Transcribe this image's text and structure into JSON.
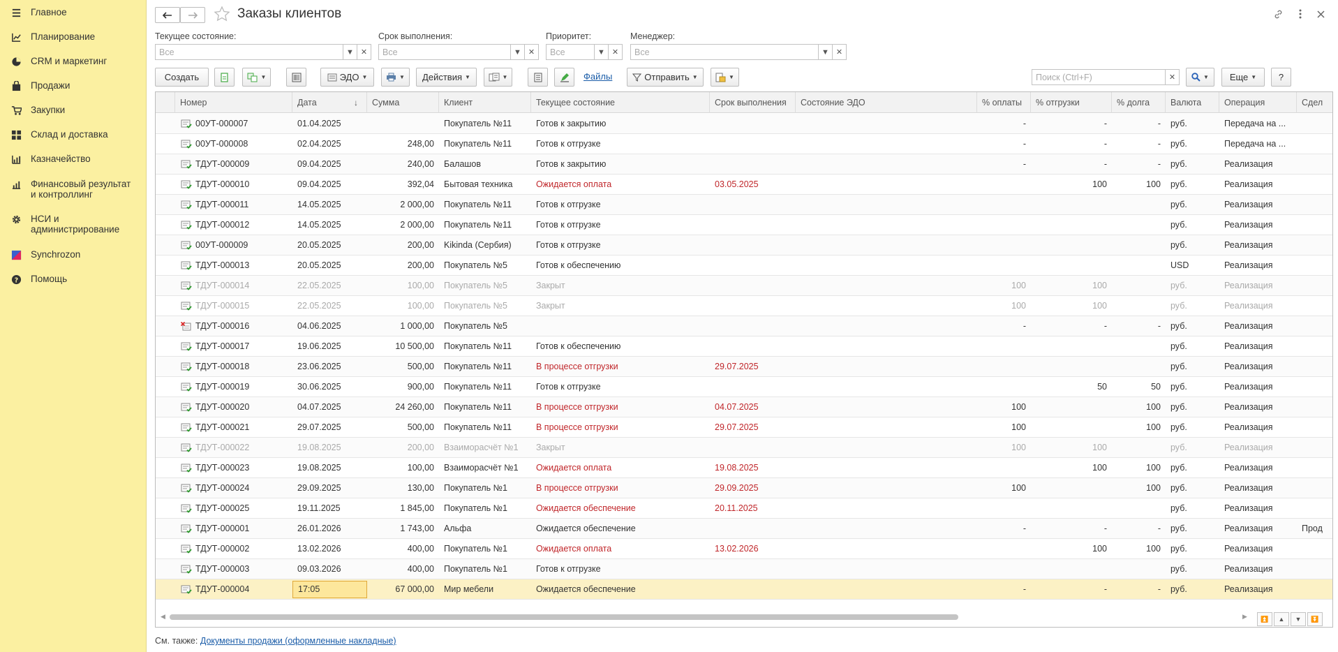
{
  "sidebar": {
    "items": [
      {
        "label": "Главное",
        "icon": "menu-icon"
      },
      {
        "label": "Планирование",
        "icon": "planning-icon"
      },
      {
        "label": "CRM и маркетинг",
        "icon": "crm-icon"
      },
      {
        "label": "Продажи",
        "icon": "sales-icon"
      },
      {
        "label": "Закупки",
        "icon": "cart-icon"
      },
      {
        "label": "Склад и доставка",
        "icon": "warehouse-icon"
      },
      {
        "label": "Казначейство",
        "icon": "treasury-icon"
      },
      {
        "label": "Финансовый результат и контроллинг",
        "icon": "finance-icon"
      },
      {
        "label": "НСИ и администрирование",
        "icon": "gear-icon"
      },
      {
        "label": "Synchrozon",
        "icon": "synchrozon-icon"
      },
      {
        "label": "Помощь",
        "icon": "help-icon"
      }
    ]
  },
  "header": {
    "title": "Заказы клиентов"
  },
  "filters": {
    "state_label": "Текущее состояние:",
    "state_placeholder": "Все",
    "deadline_label": "Срок выполнения:",
    "deadline_placeholder": "Все",
    "priority_label": "Приоритет:",
    "priority_placeholder": "Все",
    "manager_label": "Менеджер:",
    "manager_placeholder": "Все"
  },
  "toolbar": {
    "create": "Создать",
    "edo": "ЭДО",
    "actions": "Действия",
    "files": "Файлы",
    "send": "Отправить",
    "search_placeholder": "Поиск (Ctrl+F)",
    "more": "Еще",
    "help": "?"
  },
  "columns": [
    "Номер",
    "Дата",
    "Сумма",
    "Клиент",
    "Текущее состояние",
    "Срок выполнения",
    "Состояние ЭДО",
    "% оплаты",
    "% отгрузки",
    "% долга",
    "Валюта",
    "Операция",
    "Сдел"
  ],
  "rows": [
    {
      "num": "00УТ-000007",
      "date": "01.04.2025",
      "sum": "",
      "client": "Покупатель №11",
      "state": "Готов к закрытию",
      "deadline": "",
      "pay": "-",
      "ship": "-",
      "debt": "-",
      "cur": "руб.",
      "op": "Передача на ...",
      "deal": "",
      "style": "",
      "icon": "ok"
    },
    {
      "num": "00УТ-000008",
      "date": "02.04.2025",
      "sum": "248,00",
      "client": "Покупатель №11",
      "state": "Готов к отгрузке",
      "deadline": "",
      "pay": "-",
      "ship": "-",
      "debt": "-",
      "cur": "руб.",
      "op": "Передача на ...",
      "deal": "",
      "style": "",
      "icon": "ok"
    },
    {
      "num": "ТДУТ-000009",
      "date": "09.04.2025",
      "sum": "240,00",
      "client": "Балашов",
      "state": "Готов к закрытию",
      "deadline": "",
      "pay": "-",
      "ship": "-",
      "debt": "-",
      "cur": "руб.",
      "op": "Реализация",
      "deal": "",
      "style": "",
      "icon": "ok"
    },
    {
      "num": "ТДУТ-000010",
      "date": "09.04.2025",
      "sum": "392,04",
      "client": "Бытовая техника",
      "state": "Ожидается оплата",
      "deadline": "03.05.2025",
      "pay": "",
      "ship": "100",
      "debt": "100",
      "cur": "руб.",
      "op": "Реализация",
      "deal": "",
      "style": "red",
      "icon": "ok"
    },
    {
      "num": "ТДУТ-000011",
      "date": "14.05.2025",
      "sum": "2 000,00",
      "client": "Покупатель №11",
      "state": "Готов к отгрузке",
      "deadline": "",
      "pay": "",
      "ship": "",
      "debt": "",
      "cur": "руб.",
      "op": "Реализация",
      "deal": "",
      "style": "",
      "icon": "ok"
    },
    {
      "num": "ТДУТ-000012",
      "date": "14.05.2025",
      "sum": "2 000,00",
      "client": "Покупатель №11",
      "state": "Готов к отгрузке",
      "deadline": "",
      "pay": "",
      "ship": "",
      "debt": "",
      "cur": "руб.",
      "op": "Реализация",
      "deal": "",
      "style": "",
      "icon": "ok"
    },
    {
      "num": "00УТ-000009",
      "date": "20.05.2025",
      "sum": "200,00",
      "client": "Kikinda (Сербия)",
      "state": "Готов к отгрузке",
      "deadline": "",
      "pay": "",
      "ship": "",
      "debt": "",
      "cur": "руб.",
      "op": "Реализация",
      "deal": "",
      "style": "",
      "icon": "ok"
    },
    {
      "num": "ТДУТ-000013",
      "date": "20.05.2025",
      "sum": "200,00",
      "client": "Покупатель №5",
      "state": "Готов к обеспечению",
      "deadline": "",
      "pay": "",
      "ship": "",
      "debt": "",
      "cur": "USD",
      "op": "Реализация",
      "deal": "",
      "style": "",
      "icon": "ok"
    },
    {
      "num": "ТДУТ-000014",
      "date": "22.05.2025",
      "sum": "100,00",
      "client": "Покупатель №5",
      "state": "Закрыт",
      "deadline": "",
      "pay": "100",
      "ship": "100",
      "debt": "",
      "cur": "руб.",
      "op": "Реализация",
      "deal": "",
      "style": "closed",
      "icon": "ok"
    },
    {
      "num": "ТДУТ-000015",
      "date": "22.05.2025",
      "sum": "100,00",
      "client": "Покупатель №5",
      "state": "Закрыт",
      "deadline": "",
      "pay": "100",
      "ship": "100",
      "debt": "",
      "cur": "руб.",
      "op": "Реализация",
      "deal": "",
      "style": "closed",
      "icon": "ok"
    },
    {
      "num": "ТДУТ-000016",
      "date": "04.06.2025",
      "sum": "1 000,00",
      "client": "Покупатель №5",
      "state": "",
      "deadline": "",
      "pay": "-",
      "ship": "-",
      "debt": "-",
      "cur": "руб.",
      "op": "Реализация",
      "deal": "",
      "style": "",
      "icon": "del"
    },
    {
      "num": "ТДУТ-000017",
      "date": "19.06.2025",
      "sum": "10 500,00",
      "client": "Покупатель №11",
      "state": "Готов к обеспечению",
      "deadline": "",
      "pay": "",
      "ship": "",
      "debt": "",
      "cur": "руб.",
      "op": "Реализация",
      "deal": "",
      "style": "",
      "icon": "ok"
    },
    {
      "num": "ТДУТ-000018",
      "date": "23.06.2025",
      "sum": "500,00",
      "client": "Покупатель №11",
      "state": "В процессе отгрузки",
      "deadline": "29.07.2025",
      "pay": "",
      "ship": "",
      "debt": "",
      "cur": "руб.",
      "op": "Реализация",
      "deal": "",
      "style": "red",
      "icon": "ok"
    },
    {
      "num": "ТДУТ-000019",
      "date": "30.06.2025",
      "sum": "900,00",
      "client": "Покупатель №11",
      "state": "Готов к отгрузке",
      "deadline": "",
      "pay": "",
      "ship": "50",
      "debt": "50",
      "cur": "руб.",
      "op": "Реализация",
      "deal": "",
      "style": "",
      "icon": "ok"
    },
    {
      "num": "ТДУТ-000020",
      "date": "04.07.2025",
      "sum": "24 260,00",
      "client": "Покупатель №11",
      "state": "В процессе отгрузки",
      "deadline": "04.07.2025",
      "pay": "100",
      "ship": "",
      "debt": "100",
      "cur": "руб.",
      "op": "Реализация",
      "deal": "",
      "style": "red",
      "icon": "ok"
    },
    {
      "num": "ТДУТ-000021",
      "date": "29.07.2025",
      "sum": "500,00",
      "client": "Покупатель №11",
      "state": "В процессе отгрузки",
      "deadline": "29.07.2025",
      "pay": "100",
      "ship": "",
      "debt": "100",
      "cur": "руб.",
      "op": "Реализация",
      "deal": "",
      "style": "red",
      "icon": "ok"
    },
    {
      "num": "ТДУТ-000022",
      "date": "19.08.2025",
      "sum": "200,00",
      "client": "Взаиморасчёт №1",
      "state": "Закрыт",
      "deadline": "",
      "pay": "100",
      "ship": "100",
      "debt": "",
      "cur": "руб.",
      "op": "Реализация",
      "deal": "",
      "style": "closed",
      "icon": "ok"
    },
    {
      "num": "ТДУТ-000023",
      "date": "19.08.2025",
      "sum": "100,00",
      "client": "Взаиморасчёт №1",
      "state": "Ожидается оплата",
      "deadline": "19.08.2025",
      "pay": "",
      "ship": "100",
      "debt": "100",
      "cur": "руб.",
      "op": "Реализация",
      "deal": "",
      "style": "red",
      "icon": "ok"
    },
    {
      "num": "ТДУТ-000024",
      "date": "29.09.2025",
      "sum": "130,00",
      "client": "Покупатель №1",
      "state": "В процессе отгрузки",
      "deadline": "29.09.2025",
      "pay": "100",
      "ship": "",
      "debt": "100",
      "cur": "руб.",
      "op": "Реализация",
      "deal": "",
      "style": "red",
      "icon": "ok"
    },
    {
      "num": "ТДУТ-000025",
      "date": "19.11.2025",
      "sum": "1 845,00",
      "client": "Покупатель №1",
      "state": "Ожидается обеспечение",
      "deadline": "20.11.2025",
      "pay": "",
      "ship": "",
      "debt": "",
      "cur": "руб.",
      "op": "Реализация",
      "deal": "",
      "style": "red",
      "icon": "ok"
    },
    {
      "num": "ТДУТ-000001",
      "date": "26.01.2026",
      "sum": "1 743,00",
      "client": "Альфа",
      "state": "Ожидается обеспечение",
      "deadline": "",
      "pay": "-",
      "ship": "-",
      "debt": "-",
      "cur": "руб.",
      "op": "Реализация",
      "deal": "Прод",
      "style": "",
      "icon": "ok"
    },
    {
      "num": "ТДУТ-000002",
      "date": "13.02.2026",
      "sum": "400,00",
      "client": "Покупатель №1",
      "state": "Ожидается оплата",
      "deadline": "13.02.2026",
      "pay": "",
      "ship": "100",
      "debt": "100",
      "cur": "руб.",
      "op": "Реализация",
      "deal": "",
      "style": "red",
      "icon": "ok"
    },
    {
      "num": "ТДУТ-000003",
      "date": "09.03.2026",
      "sum": "400,00",
      "client": "Покупатель №1",
      "state": "Готов к отгрузке",
      "deadline": "",
      "pay": "",
      "ship": "",
      "debt": "",
      "cur": "руб.",
      "op": "Реализация",
      "deal": "",
      "style": "",
      "icon": "ok"
    },
    {
      "num": "ТДУТ-000004",
      "date": "17:05",
      "sum": "67 000,00",
      "client": "Мир мебели",
      "state": "Ожидается обеспечение",
      "deadline": "",
      "pay": "-",
      "ship": "-",
      "debt": "-",
      "cur": "руб.",
      "op": "Реализация",
      "deal": "",
      "style": "sel",
      "icon": "ok"
    }
  ],
  "footer": {
    "prefix": "См. также:",
    "link": "Документы продажи (оформленные накладные)"
  },
  "colors": {
    "sidebar_bg": "#fbf0a1",
    "accent_red": "#c0262a",
    "link_blue": "#1a5ca8",
    "selected_row": "#fcf1c5"
  }
}
